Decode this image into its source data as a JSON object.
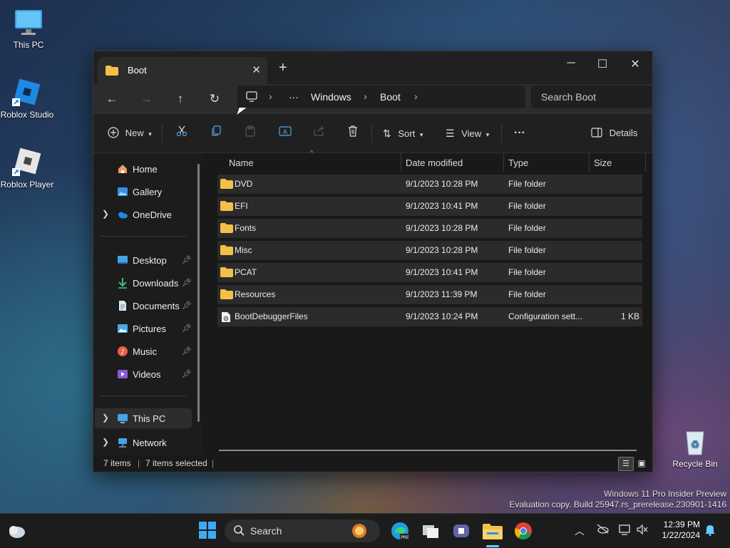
{
  "desktop": {
    "icons": [
      {
        "label": "This PC"
      },
      {
        "label": "Roblox Studio"
      },
      {
        "label": "Roblox Player"
      },
      {
        "label": "Recycle Bin"
      }
    ],
    "watermark": {
      "line1": "Windows 11 Pro Insider Preview",
      "line2": "Evaluation copy. Build 25947.rs_prerelease.230901-1416"
    }
  },
  "window": {
    "tab_title": "Boot",
    "address": {
      "ellipsis": "···",
      "segments": [
        "Windows",
        "Boot"
      ]
    },
    "search_placeholder": "Search Boot",
    "toolbar": {
      "new_label": "New",
      "sort_label": "Sort",
      "view_label": "View",
      "more_label": "···",
      "details_label": "Details"
    },
    "sidebar": {
      "top": [
        {
          "label": "Home",
          "icon": "home-icon"
        },
        {
          "label": "Gallery",
          "icon": "gallery-icon"
        },
        {
          "label": "OneDrive",
          "icon": "cloud-icon"
        }
      ],
      "quick": [
        {
          "label": "Desktop",
          "icon": "desktop-icon"
        },
        {
          "label": "Downloads",
          "icon": "download-icon"
        },
        {
          "label": "Documents",
          "icon": "documents-icon"
        },
        {
          "label": "Pictures",
          "icon": "pictures-icon"
        },
        {
          "label": "Music",
          "icon": "music-icon"
        },
        {
          "label": "Videos",
          "icon": "videos-icon"
        }
      ],
      "bottom": [
        {
          "label": "This PC",
          "icon": "pc-icon"
        },
        {
          "label": "Network",
          "icon": "network-icon"
        }
      ]
    },
    "columns": [
      "Name",
      "Date modified",
      "Type",
      "Size"
    ],
    "rows": [
      {
        "name": "DVD",
        "date": "9/1/2023 10:28 PM",
        "type": "File folder",
        "size": ""
      },
      {
        "name": "EFI",
        "date": "9/1/2023 10:41 PM",
        "type": "File folder",
        "size": ""
      },
      {
        "name": "Fonts",
        "date": "9/1/2023 10:28 PM",
        "type": "File folder",
        "size": ""
      },
      {
        "name": "Misc",
        "date": "9/1/2023 10:28 PM",
        "type": "File folder",
        "size": ""
      },
      {
        "name": "PCAT",
        "date": "9/1/2023 10:41 PM",
        "type": "File folder",
        "size": ""
      },
      {
        "name": "Resources",
        "date": "9/1/2023 11:39 PM",
        "type": "File folder",
        "size": ""
      },
      {
        "name": "BootDebuggerFiles",
        "date": "9/1/2023 10:24 PM",
        "type": "Configuration sett...",
        "size": "1 KB"
      }
    ],
    "status": {
      "items": "7 items",
      "selected": "7 items selected"
    }
  },
  "taskbar": {
    "search_label": "Search",
    "time": "12:39 PM",
    "date": "1/22/2024"
  },
  "colors": {
    "folder": "#f5c04a",
    "accent": "#60cdff"
  }
}
